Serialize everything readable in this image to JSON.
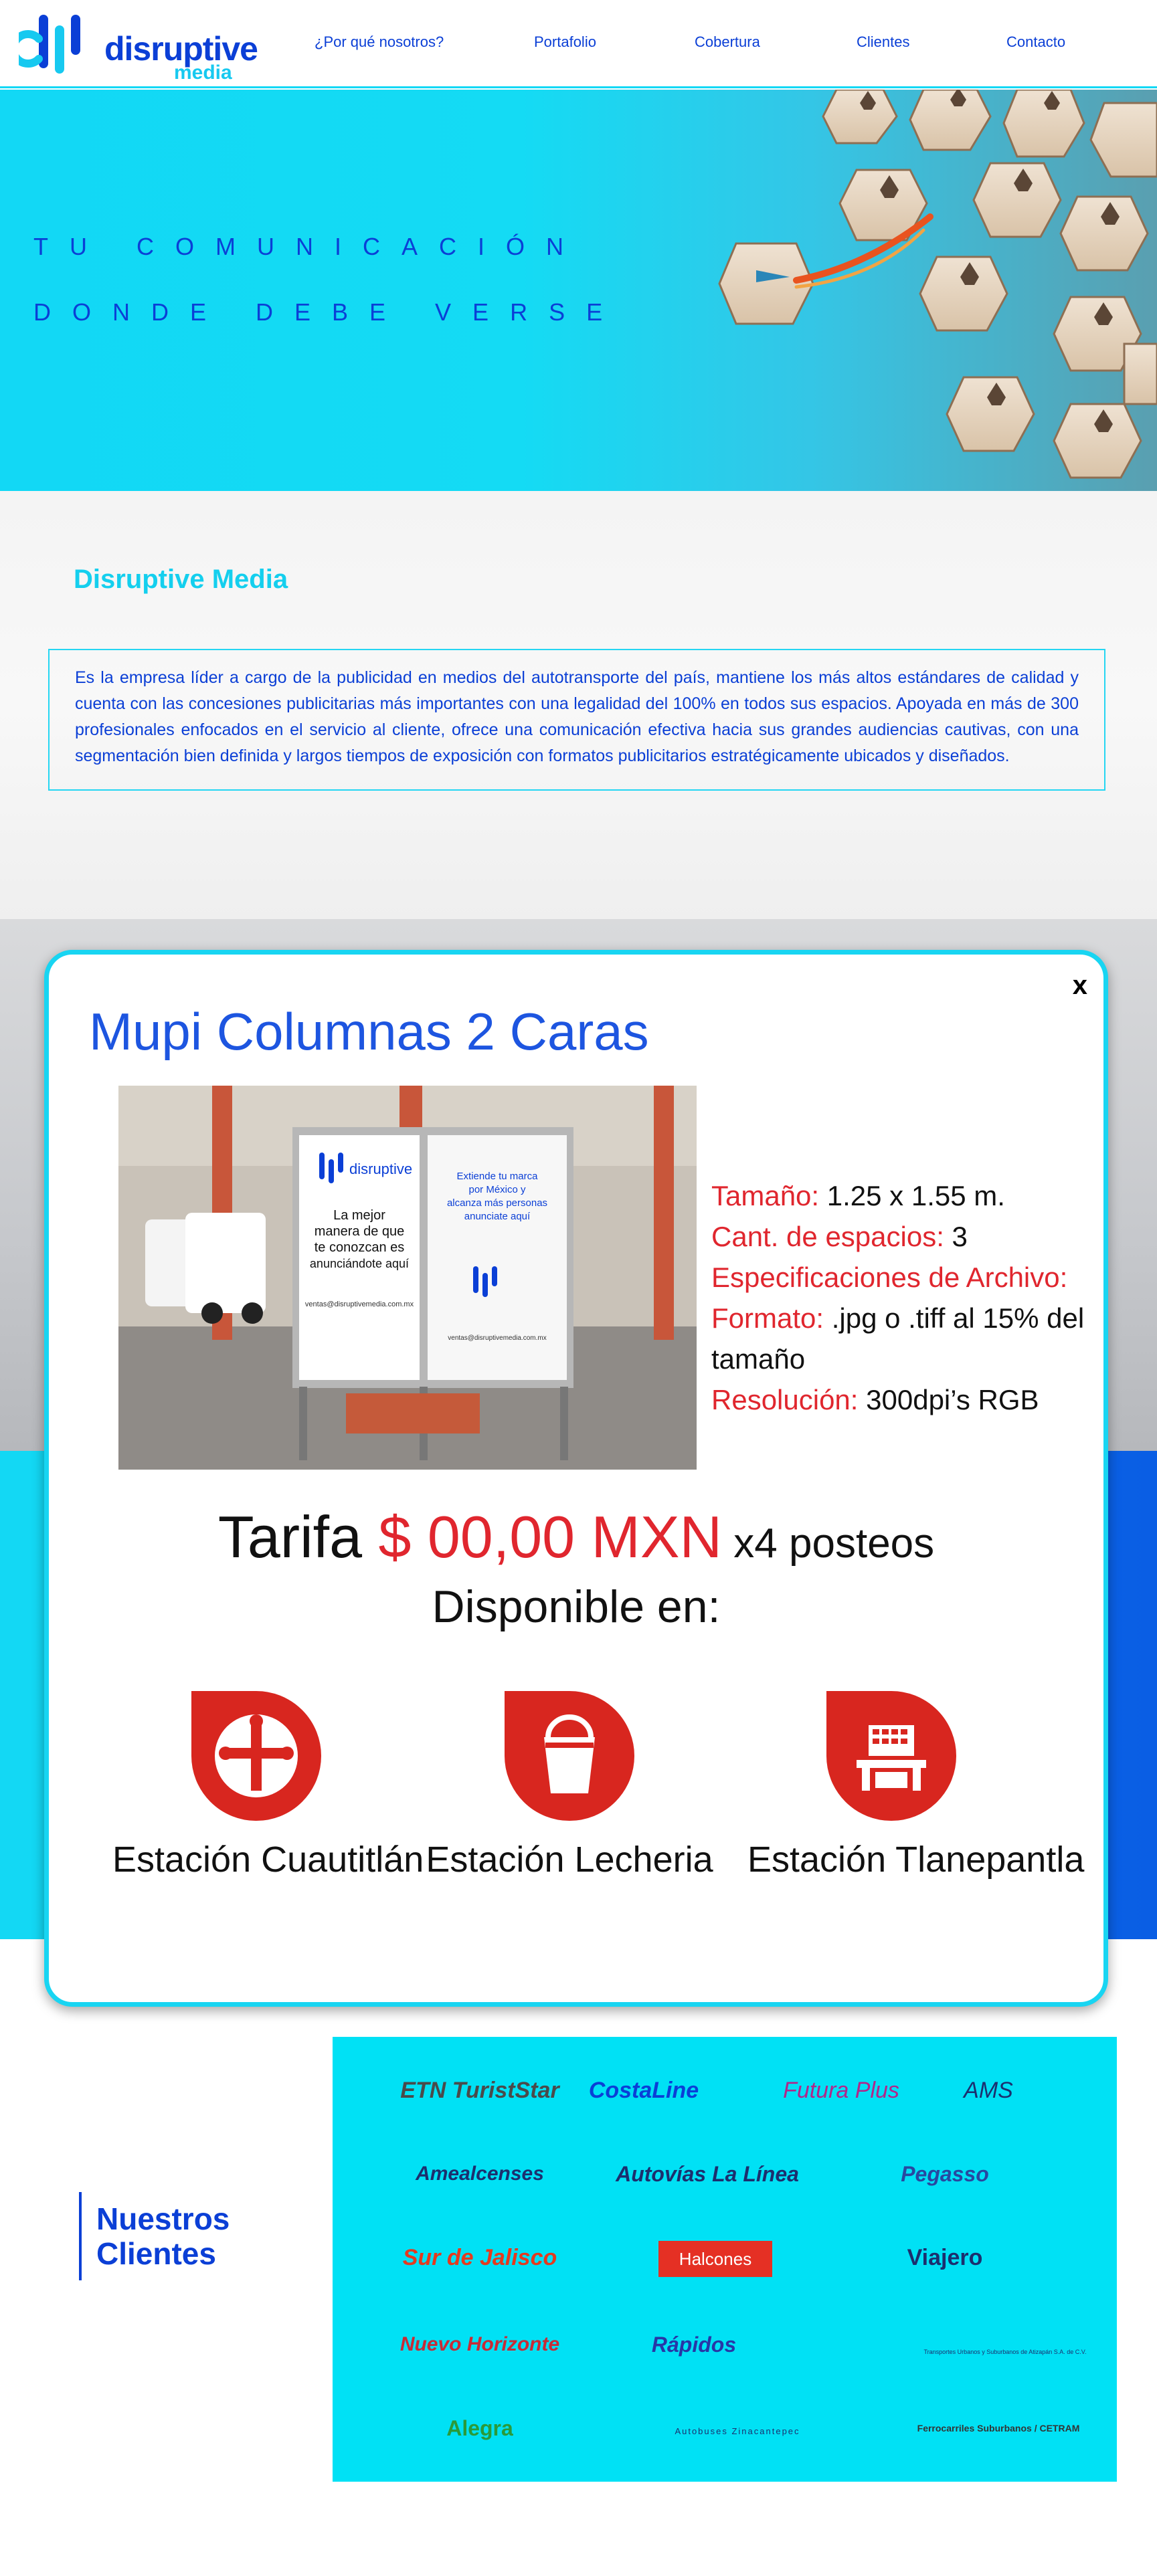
{
  "brand": {
    "name": "disruptive",
    "sub": "media"
  },
  "nav": {
    "items": [
      {
        "label": "¿Por qué nosotros?"
      },
      {
        "label": "Portafolio"
      },
      {
        "label": "Cobertura"
      },
      {
        "label": "Clientes"
      },
      {
        "label": "Contacto"
      }
    ]
  },
  "hero": {
    "line1": "TU COMUNICACIÓN",
    "line2": "DONDE DEBE VERSE"
  },
  "about": {
    "title": "Disruptive Media",
    "text": "Es la empresa líder a cargo de la publicidad en medios del  autotransporte del país, mantiene los más altos estándares de calidad y cuenta con las concesiones publicitarias más importantes  con una legalidad del 100% en todos sus espacios. Apoyada en más de 300 profesionales enfocados en el servicio al cliente, ofrece una comunicación efectiva hacia sus grandes audiencias cautivas, con una segmentación bien definida y largos tiempos de exposición con formatos publicitarios estratégicamente ubicados y diseñados."
  },
  "modal": {
    "close": "x",
    "title": "Mupi Columnas 2 Caras",
    "photo": {
      "face1_line1": "La mejor",
      "face1_line2": "manera de que",
      "face1_line3": "te conozcan es",
      "face1_line4": "anunciándote aquí",
      "face1_email": "ventas@disruptivemedia.com.mx",
      "face2_line1": "Extiende tu marca",
      "face2_line2": "por México y",
      "face2_line3": "alcanza más personas",
      "face2_line4": "anunciate aquí",
      "face2_email": "ventas@disruptivemedia.com.mx"
    },
    "specs": {
      "size_label": "Tamaño:",
      "size_value": " 1.25 x 1.55 m.",
      "spaces_label": "Cant. de espacios:",
      "spaces_value": " 3",
      "file_label": "Especificaciones de Archivo:",
      "format_label": "Formato:",
      "format_value": " .jpg o .tiff al 15% del tamaño",
      "resolution_label": "Resolución:",
      "resolution_value": " 300dpi’s RGB"
    },
    "tarifa_label": "Tarifa ",
    "tarifa_price": "$ 00,00 MXN",
    "tarifa_unit": " x4 posteos",
    "disponible": "Disponible en:",
    "stations": [
      {
        "label": "Estación Cuautitlán",
        "icon": "cross-icon"
      },
      {
        "label": "Estación Lecheria",
        "icon": "milk-bucket-icon"
      },
      {
        "label": "Estación Tlanepantla",
        "icon": "building-icon"
      }
    ]
  },
  "clients": {
    "title_line1": "Nuestros",
    "title_line2": "Clientes",
    "logos": [
      "ETN TuristStar",
      "CostaLine",
      "Futura Plus",
      "AMS",
      "Amealcenses",
      "Autovías La Línea",
      "Pegasso",
      "Sur de Jalisco",
      "Halcones",
      "Viajero",
      "Nuevo Horizonte",
      "Rápidos",
      "Transportes Urbanos y Suburbanos de Atizapán S.A. de C.V.",
      "Alegra",
      "Autobuses Zinacantepec",
      "Ferrocarriles Suburbanos / CETRAM"
    ]
  }
}
